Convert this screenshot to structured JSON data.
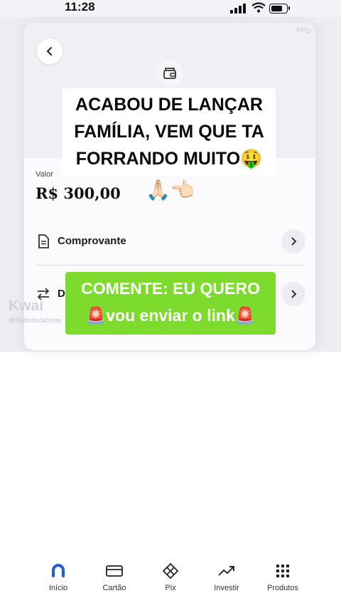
{
  "status_bar": {
    "time": "11:28"
  },
  "header": {
    "watermark": "PPG"
  },
  "overlay": {
    "caption_top": "ACABOU DE LANÇAR FAMÍLIA, VEM QUE TA FORRANDO MUITO🤑",
    "hands": "🙏🏻👈🏻",
    "caption_bottom_line1": "COMENTE: EU QUERO",
    "caption_bottom_line2": "🚨vou enviar o link🚨"
  },
  "amount": {
    "label": "Valor",
    "value": "R$ 300,00"
  },
  "rows": [
    {
      "label": "Comprovante",
      "icon": "document-icon"
    },
    {
      "label": "De",
      "icon": "transfer-icon"
    }
  ],
  "watermark": {
    "brand": "Kwai",
    "user": "@RadinhodaSorte"
  },
  "bottom_nav": [
    {
      "label": "Início",
      "icon": "home-ring-icon",
      "active": true
    },
    {
      "label": "Cartão",
      "icon": "card-icon"
    },
    {
      "label": "Pix",
      "icon": "pix-icon"
    },
    {
      "label": "Investir",
      "icon": "chart-up-icon"
    },
    {
      "label": "Produtos",
      "icon": "grid-icon"
    }
  ],
  "colors": {
    "accent": "#1f5fd6",
    "caption_green": "#7cdb2c"
  }
}
